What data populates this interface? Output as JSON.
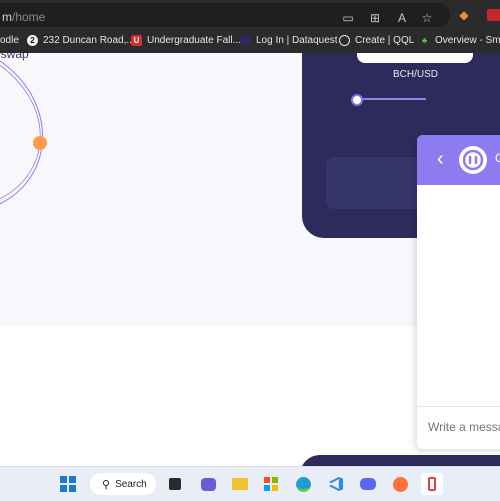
{
  "browser": {
    "url_visible": "m",
    "url_path": "/home",
    "toolbar_icons": [
      "reader-icon",
      "extensions-grid-icon",
      "text-size-icon",
      "favorite-star-icon",
      "metamask-icon",
      "pdf-icon"
    ],
    "bookmarks": [
      {
        "label": "odle",
        "icon": "bookmark-icon"
      },
      {
        "label": "232 Duncan Road,...",
        "icon": "number-2-icon"
      },
      {
        "label": "Undergraduate Fall...",
        "icon": "u-logo-icon"
      },
      {
        "label": "Log In | Dataquest",
        "icon": "dataquest-icon"
      },
      {
        "label": "Create | QQL",
        "icon": "qql-icon"
      },
      {
        "label": "Overview - Smart",
        "icon": "leaf-icon"
      }
    ]
  },
  "page": {
    "brand_text": "iswap",
    "pair_label": "BCH/USD",
    "accent_color": "#8c7cf0",
    "dark_card_color": "#2c2b5b",
    "orange_dot_color": "#ff9a4a"
  },
  "chat": {
    "name_partial": "C",
    "input_placeholder": "Write a message"
  },
  "taskbar": {
    "search_label": "Search",
    "apps": [
      "windows-start-icon",
      "search-icon",
      "task-view-icon",
      "teams-icon",
      "file-explorer-icon",
      "store-icon",
      "edge-icon",
      "vscode-icon",
      "discord-icon",
      "firefox-icon",
      "snipping-tool-icon"
    ]
  }
}
